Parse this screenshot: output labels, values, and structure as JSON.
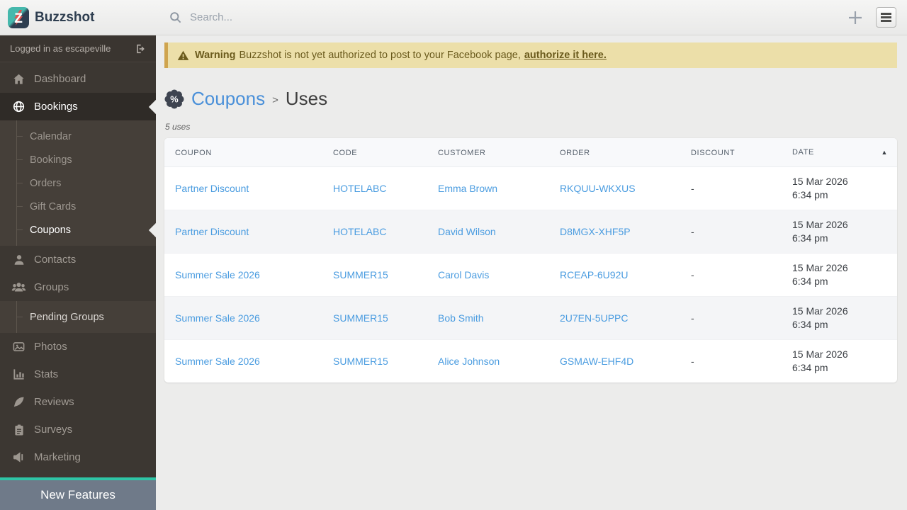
{
  "topbar": {
    "brand": "Buzzshot",
    "search_placeholder": "Search...",
    "icons": {
      "search": "search-icon",
      "add": "plus-icon",
      "menu": "hamburger-icon"
    }
  },
  "sidebar": {
    "logged_in_text": "Logged in as escapeville",
    "logout_icon": "logout-icon",
    "menu": [
      {
        "label": "Dashboard",
        "icon": "home-icon"
      },
      {
        "label": "Bookings",
        "icon": "globe-icon",
        "active": true,
        "submenu": [
          "Calendar",
          "Bookings",
          "Orders",
          "Gift Cards",
          "Coupons"
        ],
        "active_submenu_item": "Coupons"
      },
      {
        "label": "Contacts",
        "icon": "user-icon"
      },
      {
        "label": "Groups",
        "icon": "users-icon",
        "submenu": [
          "Pending Groups"
        ]
      },
      {
        "label": "Photos",
        "icon": "photo-icon"
      },
      {
        "label": "Stats",
        "icon": "bar-chart-icon"
      },
      {
        "label": "Reviews",
        "icon": "feather-icon"
      },
      {
        "label": "Surveys",
        "icon": "clipboard-icon"
      },
      {
        "label": "Marketing",
        "icon": "megaphone-icon"
      }
    ],
    "footer_label": "New Features"
  },
  "warning": {
    "title": "Warning",
    "message": "Buzzshot is not yet authorized to post to your Facebook page,",
    "link_text": "authorize it here."
  },
  "page": {
    "breadcrumb_link": "Coupons",
    "breadcrumb_separator": ">",
    "title": "Uses",
    "badge_icon": "percent-badge-icon",
    "uses_count": "5 uses"
  },
  "table": {
    "headers": [
      "COUPON",
      "CODE",
      "CUSTOMER",
      "ORDER",
      "DISCOUNT",
      "DATE"
    ],
    "sort_icon": "▲",
    "rows": [
      {
        "coupon": "Partner Discount",
        "code": "HOTELABC",
        "customer": "Emma Brown",
        "order": "RKQUU-WKXUS",
        "discount": "-",
        "date": "15 Mar 2026",
        "time": "6:34 pm"
      },
      {
        "coupon": "Partner Discount",
        "code": "HOTELABC",
        "customer": "David Wilson",
        "order": "D8MGX-XHF5P",
        "discount": "-",
        "date": "15 Mar 2026",
        "time": "6:34 pm"
      },
      {
        "coupon": "Summer Sale 2026",
        "code": "SUMMER15",
        "customer": "Carol Davis",
        "order": "RCEAP-6U92U",
        "discount": "-",
        "date": "15 Mar 2026",
        "time": "6:34 pm"
      },
      {
        "coupon": "Summer Sale 2026",
        "code": "SUMMER15",
        "customer": "Bob Smith",
        "order": "2U7EN-5UPPC",
        "discount": "-",
        "date": "15 Mar 2026",
        "time": "6:34 pm"
      },
      {
        "coupon": "Summer Sale 2026",
        "code": "SUMMER15",
        "customer": "Alice Johnson",
        "order": "GSMAW-EHF4D",
        "discount": "-",
        "date": "15 Mar 2026",
        "time": "6:34 pm"
      }
    ]
  },
  "colors": {
    "accent_teal": "#2ec4a5",
    "link_blue": "#4a9ce0",
    "breadcrumb_blue": "#4a90d9",
    "brand_navy": "#2e3e50",
    "sidebar_bg": "#3c3732",
    "footer_bar": "#6f7a89",
    "warning_bg": "#ecdfa9",
    "warning_border": "#cfa44e",
    "warning_text": "#6b5b1d"
  }
}
